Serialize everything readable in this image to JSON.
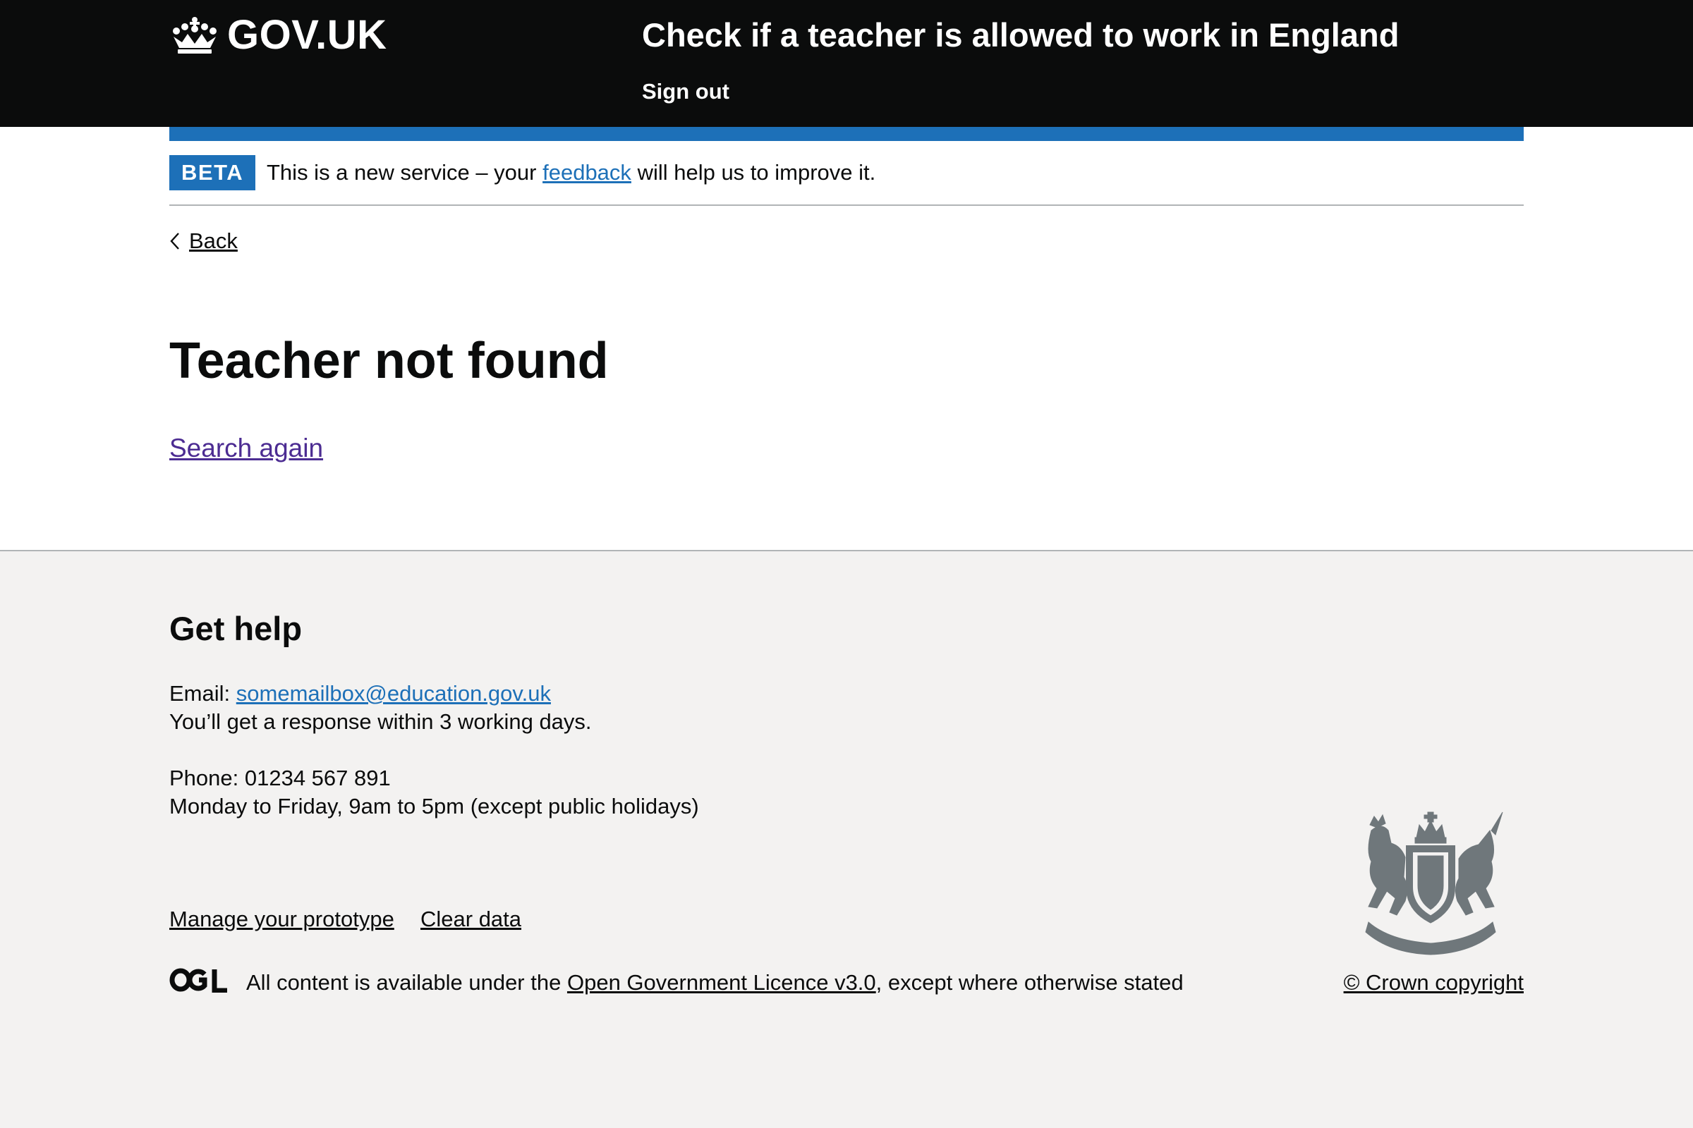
{
  "header": {
    "logo_text": "GOV.UK",
    "logo_icon": "crown-icon",
    "service_name": "Check if a teacher is allowed to work in England",
    "sign_out": "Sign out"
  },
  "phase_banner": {
    "tag": "BETA",
    "text_before": "This is a new service – your",
    "feedback_link": "feedback",
    "text_after": "will help us to improve it."
  },
  "back_link": {
    "icon": "chevron-left-icon",
    "label": "Back"
  },
  "main": {
    "title": "Teacher not found",
    "search_again": "Search again"
  },
  "footer": {
    "help_heading": "Get help",
    "email_label": "Email:",
    "email": "somemailbox@education.gov.uk",
    "email_response": "You’ll get a response within 3 working days.",
    "phone": "Phone: 01234 567 891",
    "phone_hours": "Monday to Friday, 9am to 5pm (except public holidays)",
    "links": [
      "Manage your prototype",
      "Clear data"
    ],
    "ogl_logo": "OGL",
    "licence_before": "All content is available under the",
    "licence_link": "Open Government Licence v3.0",
    "licence_after": ", except where otherwise stated",
    "crest_icon": "royal-coat-of-arms-icon",
    "copyright": "© Crown copyright"
  },
  "colors": {
    "header_bg": "#0b0c0c",
    "brand_blue": "#1d70b8",
    "visited_link": "#4c2c92",
    "footer_bg": "#f3f2f1",
    "border": "#b1b4b6",
    "crest": "#6f777b"
  }
}
